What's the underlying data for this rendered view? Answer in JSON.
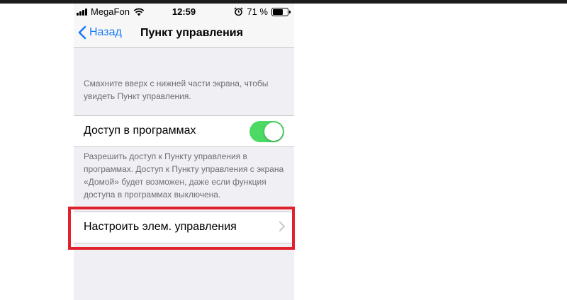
{
  "status_bar": {
    "carrier": "MegaFon",
    "time": "12:59",
    "battery_percent": "71 %",
    "battery_level": 0.71,
    "icons": [
      "signal-icon",
      "wifi-icon",
      "alarm-icon",
      "battery-icon"
    ]
  },
  "nav": {
    "back_label": "Назад",
    "title": "Пункт управления"
  },
  "sections": {
    "intro_text": "Смахните вверх с нижней части экрана, чтобы увидеть Пункт управления.",
    "apps_access": {
      "label": "Доступ в программах",
      "enabled": true
    },
    "apps_access_footer": "Разрешить доступ к Пункту управления в программах. Доступ к Пункту управления с экрана «Домой» будет возможен, даже если функция доступа в программах выключена.",
    "customize": {
      "label": "Настроить элем. управления"
    }
  },
  "colors": {
    "accent": "#1a7cf5",
    "toggle_on": "#4cd964",
    "highlight": "#e0212b",
    "background": "#efeff4"
  }
}
